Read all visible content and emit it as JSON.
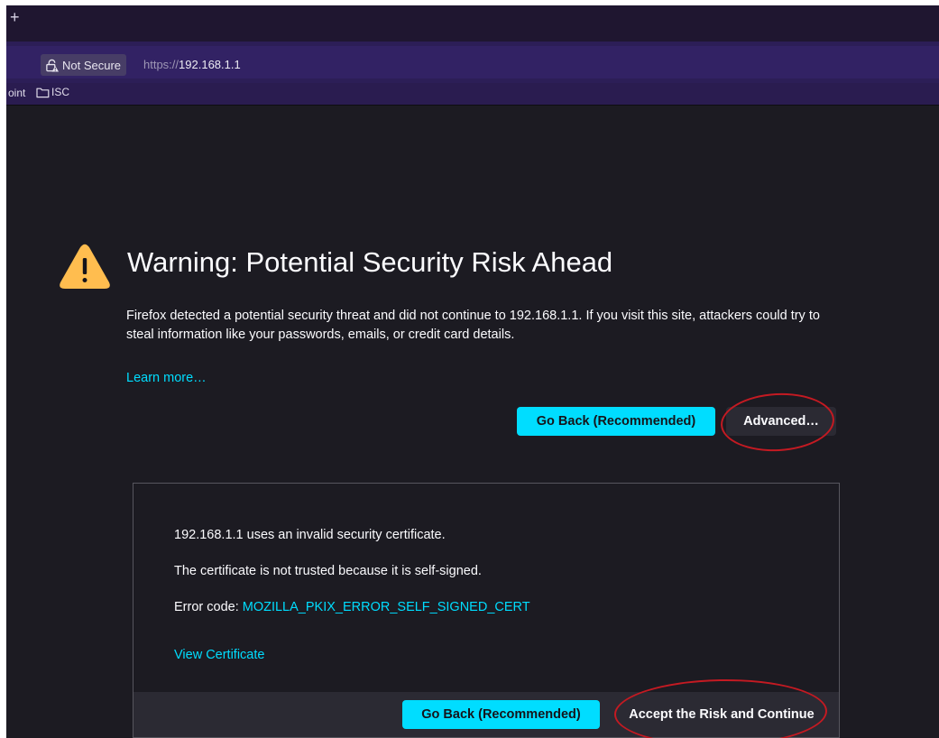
{
  "browser": {
    "new_tab_symbol": "+",
    "site_identity": {
      "label": "Not Secure",
      "icon": "lock-warning-icon"
    },
    "url": {
      "scheme": "https://",
      "host": "192.168.1.1"
    },
    "bookmarks": [
      {
        "label": "oint",
        "icon": null
      },
      {
        "label": "ISC",
        "icon": "folder-icon"
      }
    ]
  },
  "page": {
    "warning_icon": "warning-triangle-icon",
    "title": "Warning: Potential Security Risk Ahead",
    "intro": "Firefox detected a potential security threat and did not continue to 192.168.1.1. If you visit this site, attackers could try to steal information like your passwords, emails, or credit card details.",
    "learn_more": "Learn more…",
    "go_back_label": "Go Back (Recommended)",
    "advanced_label": "Advanced…",
    "advanced_panel": {
      "line1": "192.168.1.1 uses an invalid security certificate.",
      "line2": "The certificate is not trusted because it is self-signed.",
      "error_prefix": "Error code: ",
      "error_code": "MOZILLA_PKIX_ERROR_SELF_SIGNED_CERT",
      "view_certificate": "View Certificate",
      "go_back_label": "Go Back (Recommended)",
      "accept_label": "Accept the Risk and Continue"
    }
  },
  "colors": {
    "page_background": "#1c1b22",
    "accent_link": "#00ddff",
    "primary_button": "#00ddff",
    "annotation": "#c41a22"
  }
}
